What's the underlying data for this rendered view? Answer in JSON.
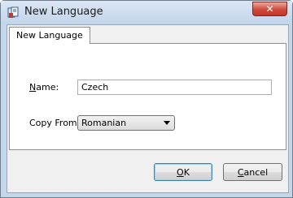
{
  "window": {
    "title": "New Language",
    "close_label": "✕",
    "app_icon": "language-app-icon"
  },
  "tab": {
    "label": "New Language"
  },
  "form": {
    "name_label_prefix": "N",
    "name_label_rest": "ame:",
    "name_value": "Czech",
    "copy_from_label": "Copy From:",
    "copy_from_selected": "Romanian"
  },
  "buttons": {
    "ok_underlined": "O",
    "ok_rest": "K",
    "cancel_underlined": "C",
    "cancel_rest": "ancel"
  },
  "colors": {
    "frame": "#c4d6ea",
    "client": "#f0f0f0",
    "close_button": "#d0493c",
    "default_button_border": "#3c7fb1"
  }
}
